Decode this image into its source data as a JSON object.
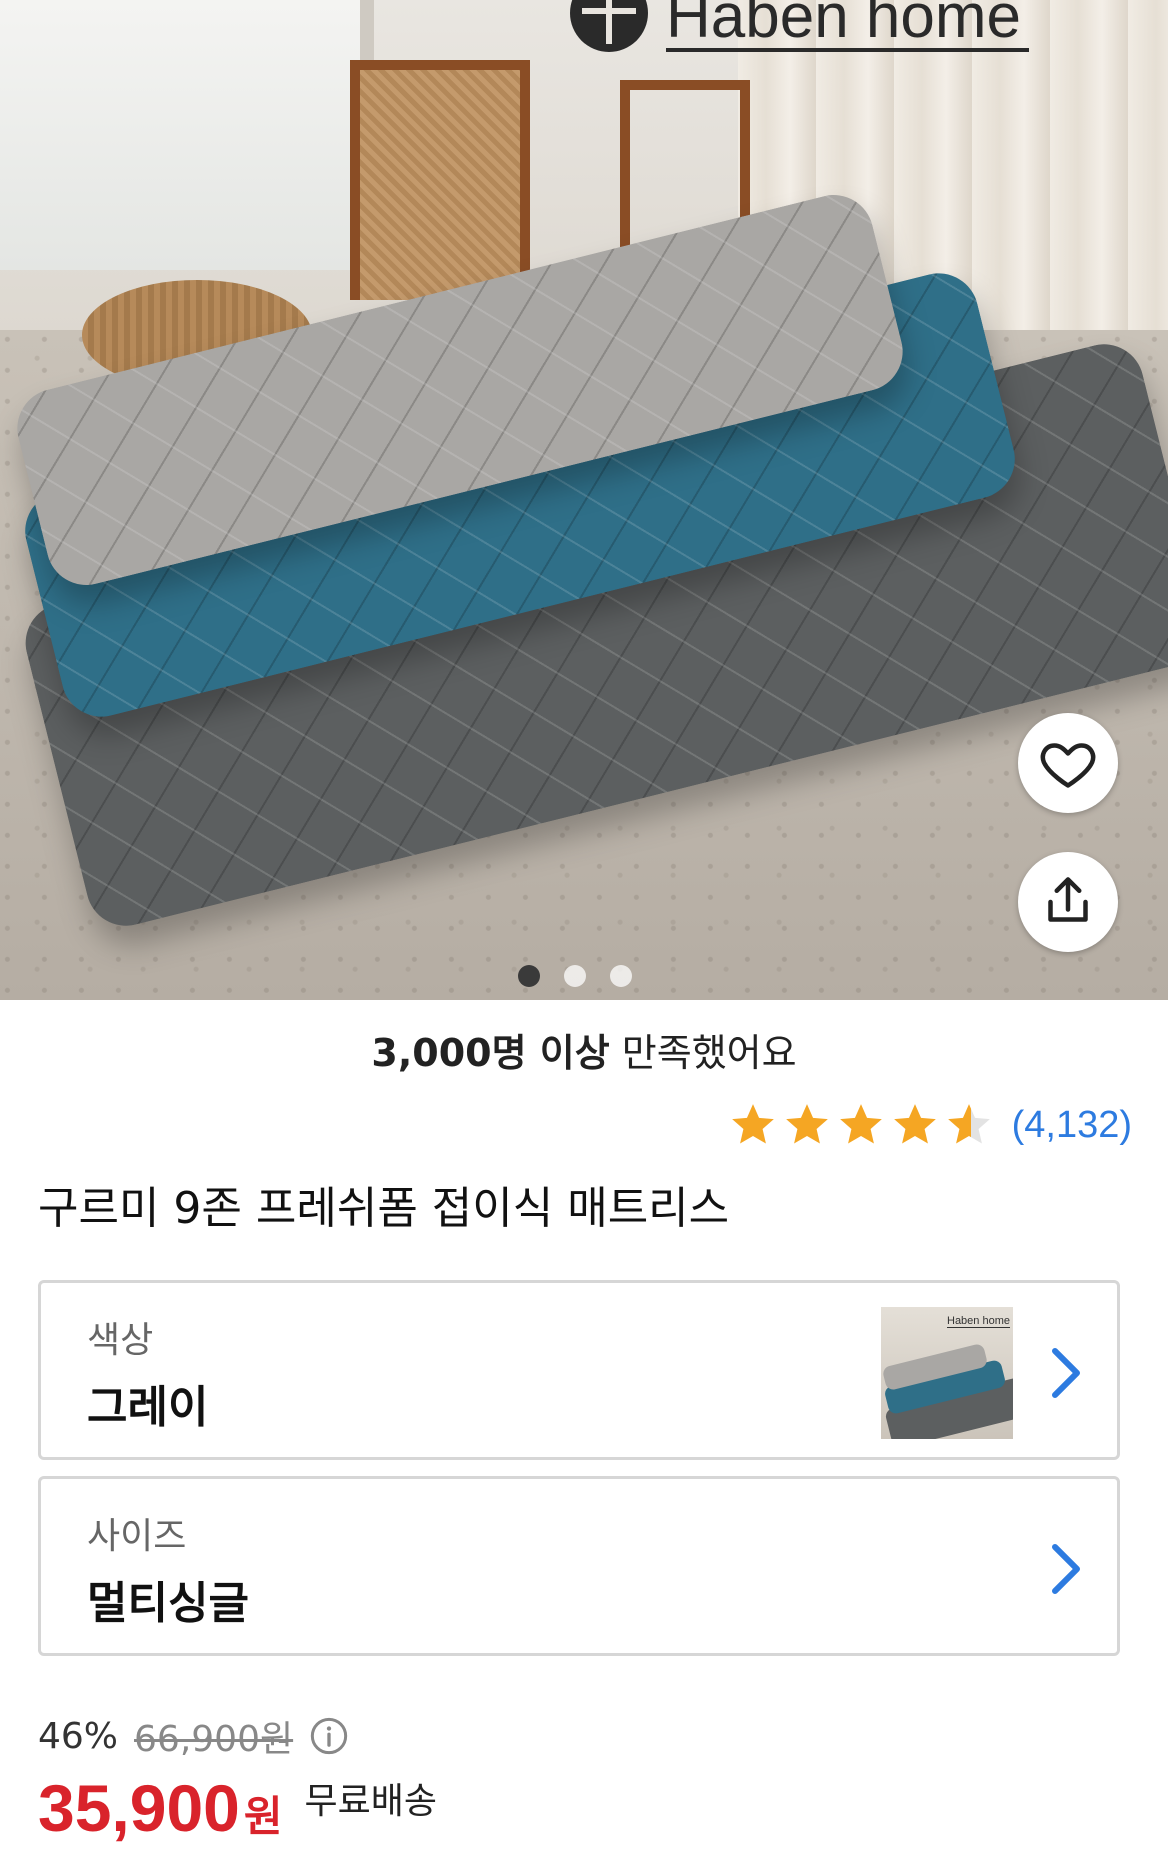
{
  "hero": {
    "brand": "Haben home",
    "image_description_icon": "mattress-photo",
    "page_dots": [
      true,
      false,
      false
    ]
  },
  "satisfaction": {
    "bold": "3,000명 이상",
    "rest": " 만족했어요"
  },
  "rating": {
    "stars": 4.5,
    "review_count": "(4,132)",
    "star_color": "#f5a623"
  },
  "product": {
    "title": "구르미 9존 프레쉬폼 접이식 매트리스"
  },
  "options": {
    "color": {
      "label": "색상",
      "value": "그레이"
    },
    "size": {
      "label": "사이즈",
      "value": "멀티싱글"
    }
  },
  "pricing": {
    "discount": "46%",
    "original_price": "66,900원",
    "price": "35,900",
    "currency": "원",
    "shipping": "무료배송",
    "price_color": "#d9232b"
  },
  "colors": {
    "accent": "#2d7be0"
  }
}
